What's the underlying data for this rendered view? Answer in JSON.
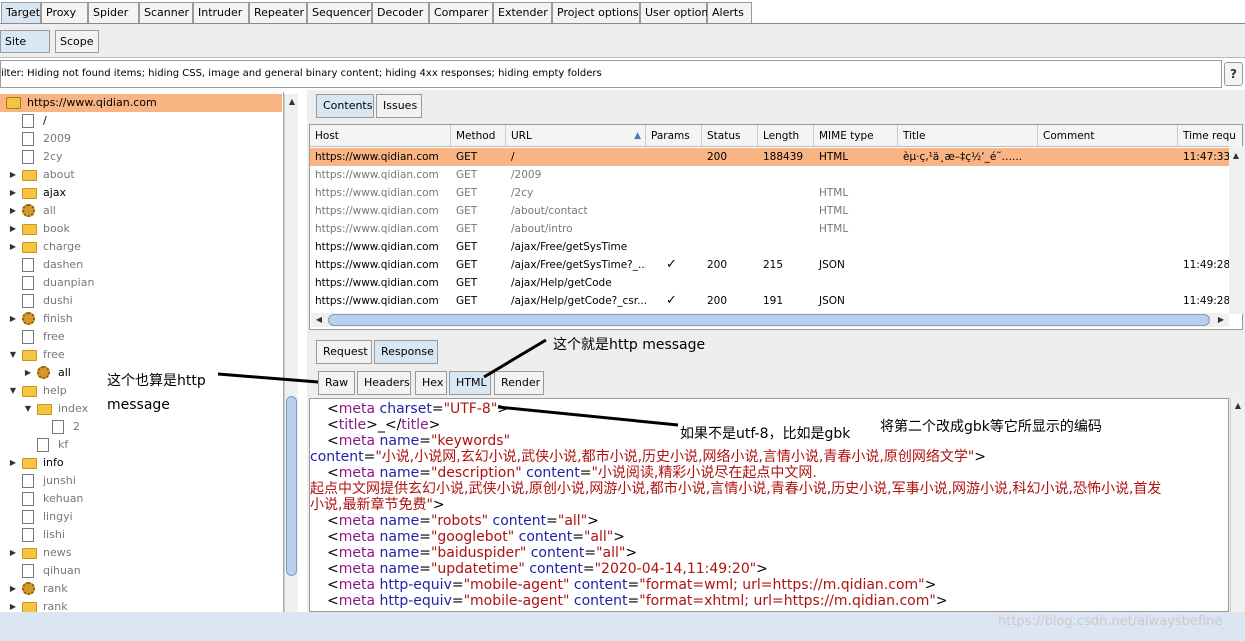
{
  "top_tabs": [
    "Target",
    "Proxy",
    "Spider",
    "Scanner",
    "Intruder",
    "Repeater",
    "Sequencer",
    "Decoder",
    "Comparer",
    "Extender",
    "Project options",
    "User options",
    "Alerts"
  ],
  "sub_tabs": [
    "Site map",
    "Scope"
  ],
  "filter_text": "ilter: Hiding not found items;  hiding CSS, image and general binary content;  hiding 4xx responses;  hiding empty folders",
  "help_label": "?",
  "tree": [
    {
      "label": "https://www.qidian.com",
      "icon": "lock-icon",
      "expand": "",
      "indent": 0,
      "selected": true,
      "gray": false
    },
    {
      "label": "/",
      "icon": "file-icon",
      "expand": "",
      "indent": 1,
      "gray": false
    },
    {
      "label": "2009",
      "icon": "file-icon",
      "expand": "",
      "indent": 1,
      "gray": true
    },
    {
      "label": "2cy",
      "icon": "file-icon",
      "expand": "",
      "indent": 1,
      "gray": true
    },
    {
      "label": "about",
      "icon": "folder-icon",
      "expand": "▶",
      "indent": 1,
      "gray": true
    },
    {
      "label": "ajax",
      "icon": "folder-icon",
      "expand": "▶",
      "indent": 1,
      "gray": false
    },
    {
      "label": "all",
      "icon": "gear-icon",
      "expand": "▶",
      "indent": 1,
      "gray": true
    },
    {
      "label": "book",
      "icon": "folder-icon",
      "expand": "▶",
      "indent": 1,
      "gray": true
    },
    {
      "label": "charge",
      "icon": "folder-icon",
      "expand": "▶",
      "indent": 1,
      "gray": true
    },
    {
      "label": "dashen",
      "icon": "file-icon",
      "expand": "",
      "indent": 1,
      "gray": true
    },
    {
      "label": "duanpian",
      "icon": "file-icon",
      "expand": "",
      "indent": 1,
      "gray": true
    },
    {
      "label": "dushi",
      "icon": "file-icon",
      "expand": "",
      "indent": 1,
      "gray": true
    },
    {
      "label": "finish",
      "icon": "gear-icon",
      "expand": "▶",
      "indent": 1,
      "gray": true
    },
    {
      "label": "free",
      "icon": "file-icon",
      "expand": "",
      "indent": 1,
      "gray": true
    },
    {
      "label": "free",
      "icon": "folder-icon",
      "expand": "▼",
      "indent": 1,
      "gray": true
    },
    {
      "label": "all",
      "icon": "gear-icon",
      "expand": "▶",
      "indent": 2,
      "gray": false
    },
    {
      "label": "help",
      "icon": "folder-icon",
      "expand": "▼",
      "indent": 1,
      "gray": true
    },
    {
      "label": "index",
      "icon": "folder-icon",
      "expand": "▼",
      "indent": 2,
      "gray": true
    },
    {
      "label": "2",
      "icon": "file-icon",
      "expand": "",
      "indent": 3,
      "gray": true
    },
    {
      "label": "kf",
      "icon": "file-icon",
      "expand": "",
      "indent": 2,
      "gray": true
    },
    {
      "label": "info",
      "icon": "folder-icon",
      "expand": "▶",
      "indent": 1,
      "gray": false
    },
    {
      "label": "junshi",
      "icon": "file-icon",
      "expand": "",
      "indent": 1,
      "gray": true
    },
    {
      "label": "kehuan",
      "icon": "file-icon",
      "expand": "",
      "indent": 1,
      "gray": true
    },
    {
      "label": "lingyi",
      "icon": "file-icon",
      "expand": "",
      "indent": 1,
      "gray": true
    },
    {
      "label": "lishi",
      "icon": "file-icon",
      "expand": "",
      "indent": 1,
      "gray": true
    },
    {
      "label": "news",
      "icon": "folder-icon",
      "expand": "▶",
      "indent": 1,
      "gray": true
    },
    {
      "label": "qihuan",
      "icon": "file-icon",
      "expand": "",
      "indent": 1,
      "gray": true
    },
    {
      "label": "rank",
      "icon": "gear-icon",
      "expand": "▶",
      "indent": 1,
      "gray": true
    },
    {
      "label": "rank",
      "icon": "folder-icon",
      "expand": "▶",
      "indent": 1,
      "gray": true
    }
  ],
  "content_tabs": [
    "Contents",
    "Issues"
  ],
  "columns": [
    "Host",
    "Method",
    "URL",
    "Params",
    "Status",
    "Length",
    "MIME type",
    "Title",
    "Comment",
    "Time requ"
  ],
  "sort_indicator": "▲",
  "rows": [
    {
      "host": "https://www.qidian.com",
      "method": "GET",
      "url": "/",
      "params": "",
      "status": "200",
      "length": "188439",
      "mime": "HTML",
      "title": "èµ·ç‚¹ä¸­æ–‡ç½‘_é˜…...",
      "comment": "",
      "time": "11:47:33",
      "selected": true,
      "muted": false
    },
    {
      "host": "https://www.qidian.com",
      "method": "GET",
      "url": "/2009",
      "params": "",
      "status": "",
      "length": "",
      "mime": "",
      "title": "",
      "comment": "",
      "time": "",
      "muted": true
    },
    {
      "host": "https://www.qidian.com",
      "method": "GET",
      "url": "/2cy",
      "params": "",
      "status": "",
      "length": "",
      "mime": "HTML",
      "title": "",
      "comment": "",
      "time": "",
      "muted": true
    },
    {
      "host": "https://www.qidian.com",
      "method": "GET",
      "url": "/about/contact",
      "params": "",
      "status": "",
      "length": "",
      "mime": "HTML",
      "title": "",
      "comment": "",
      "time": "",
      "muted": true
    },
    {
      "host": "https://www.qidian.com",
      "method": "GET",
      "url": "/about/intro",
      "params": "",
      "status": "",
      "length": "",
      "mime": "HTML",
      "title": "",
      "comment": "",
      "time": "",
      "muted": true
    },
    {
      "host": "https://www.qidian.com",
      "method": "GET",
      "url": "/ajax/Free/getSysTime",
      "params": "",
      "status": "",
      "length": "",
      "mime": "",
      "title": "",
      "comment": "",
      "time": "",
      "muted": false
    },
    {
      "host": "https://www.qidian.com",
      "method": "GET",
      "url": "/ajax/Free/getSysTime?_...",
      "params": "✓",
      "status": "200",
      "length": "215",
      "mime": "JSON",
      "title": "",
      "comment": "",
      "time": "11:49:28",
      "muted": false
    },
    {
      "host": "https://www.qidian.com",
      "method": "GET",
      "url": "/ajax/Help/getCode",
      "params": "",
      "status": "",
      "length": "",
      "mime": "",
      "title": "",
      "comment": "",
      "time": "",
      "muted": false
    },
    {
      "host": "https://www.qidian.com",
      "method": "GET",
      "url": "/ajax/Help/getCode?_csr...",
      "params": "✓",
      "status": "200",
      "length": "191",
      "mime": "JSON",
      "title": "",
      "comment": "",
      "time": "11:49:28",
      "muted": false
    }
  ],
  "req_resp_tabs": [
    "Request",
    "Response"
  ],
  "view_tabs": [
    "Raw",
    "Headers",
    "Hex",
    "HTML",
    "Render"
  ],
  "code_lines": [
    [
      [
        "tag",
        "<"
      ],
      [
        "tn",
        "meta"
      ],
      [
        "an",
        " charset"
      ],
      [
        "tag",
        "="
      ],
      [
        "av",
        "\"UTF-8\""
      ],
      [
        "tag",
        ">"
      ]
    ],
    [
      [
        "tag",
        "<"
      ],
      [
        "tn",
        "title"
      ],
      [
        "tag",
        ">_</"
      ],
      [
        "tn",
        "title"
      ],
      [
        "tag",
        ">"
      ]
    ],
    [
      [
        "tag",
        "<"
      ],
      [
        "tn",
        "meta"
      ],
      [
        "an",
        " name"
      ],
      [
        "tag",
        "="
      ],
      [
        "av",
        "\"keywords\""
      ]
    ],
    [
      [
        "an",
        "content"
      ],
      [
        "tag",
        "="
      ],
      [
        "av",
        "\"小说,小说网,玄幻小说,武侠小说,都市小说,历史小说,网络小说,言情小说,青春小说,原创网络文学\""
      ],
      [
        "tag",
        ">"
      ]
    ],
    [
      [
        "tag",
        "<"
      ],
      [
        "tn",
        "meta"
      ],
      [
        "an",
        " name"
      ],
      [
        "tag",
        "="
      ],
      [
        "av",
        "\"description\""
      ],
      [
        "an",
        " content"
      ],
      [
        "tag",
        "="
      ],
      [
        "av",
        "\"小说阅读,精彩小说尽在起点中文网."
      ]
    ],
    [
      [
        "av",
        "起点中文网提供玄幻小说,武侠小说,原创小说,网游小说,都市小说,言情小说,青春小说,历史小说,军事小说,网游小说,科幻小说,恐怖小说,首发"
      ]
    ],
    [
      [
        "av",
        "小说,最新章节免费\""
      ],
      [
        "tag",
        ">"
      ]
    ],
    [
      [
        "tag",
        "<"
      ],
      [
        "tn",
        "meta"
      ],
      [
        "an",
        " name"
      ],
      [
        "tag",
        "="
      ],
      [
        "av",
        "\"robots\""
      ],
      [
        "an",
        " content"
      ],
      [
        "tag",
        "="
      ],
      [
        "av",
        "\"all\""
      ],
      [
        "tag",
        ">"
      ]
    ],
    [
      [
        "tag",
        "<"
      ],
      [
        "tn",
        "meta"
      ],
      [
        "an",
        " name"
      ],
      [
        "tag",
        "="
      ],
      [
        "av",
        "\"googlebot\""
      ],
      [
        "an",
        " content"
      ],
      [
        "tag",
        "="
      ],
      [
        "av",
        "\"all\""
      ],
      [
        "tag",
        ">"
      ]
    ],
    [
      [
        "tag",
        "<"
      ],
      [
        "tn",
        "meta"
      ],
      [
        "an",
        " name"
      ],
      [
        "tag",
        "="
      ],
      [
        "av",
        "\"baiduspider\""
      ],
      [
        "an",
        " content"
      ],
      [
        "tag",
        "="
      ],
      [
        "av",
        "\"all\""
      ],
      [
        "tag",
        ">"
      ]
    ],
    [
      [
        "tag",
        "<"
      ],
      [
        "tn",
        "meta"
      ],
      [
        "an",
        " name"
      ],
      [
        "tag",
        "="
      ],
      [
        "av",
        "\"updatetime\""
      ],
      [
        "an",
        " content"
      ],
      [
        "tag",
        "="
      ],
      [
        "av",
        "\"2020-04-14,11:49:20\""
      ],
      [
        "tag",
        ">"
      ]
    ],
    [
      [
        "tag",
        "<"
      ],
      [
        "tn",
        "meta"
      ],
      [
        "an",
        " http-equiv"
      ],
      [
        "tag",
        "="
      ],
      [
        "av",
        "\"mobile-agent\""
      ],
      [
        "an",
        " content"
      ],
      [
        "tag",
        "="
      ],
      [
        "av",
        "\"format=wml; url=https://m.qidian.com\""
      ],
      [
        "tag",
        ">"
      ]
    ],
    [
      [
        "tag",
        "<"
      ],
      [
        "tn",
        "meta"
      ],
      [
        "an",
        " http-equiv"
      ],
      [
        "tag",
        "="
      ],
      [
        "av",
        "\"mobile-agent\""
      ],
      [
        "an",
        " content"
      ],
      [
        "tag",
        "="
      ],
      [
        "av",
        "\"format=xhtml; url=https://m.qidian.com\""
      ],
      [
        "tag",
        ">"
      ]
    ]
  ],
  "annotations": {
    "left_line1": "这个也算是http",
    "left_line2": "message",
    "top": "这个就是http  message",
    "right1": "如果不是utf-8，比如是gbk",
    "right2": "将第二个改成gbk等它所显示的编码"
  },
  "watermark": "https://blog.csdn.net/alwaysbefine",
  "colors": {
    "selected_row": "#f8b482",
    "active_tab": "#d9e6f4",
    "tag_name": "#8b1a8b",
    "attr_name": "#1f1faa",
    "attr_value": "#b01212"
  }
}
